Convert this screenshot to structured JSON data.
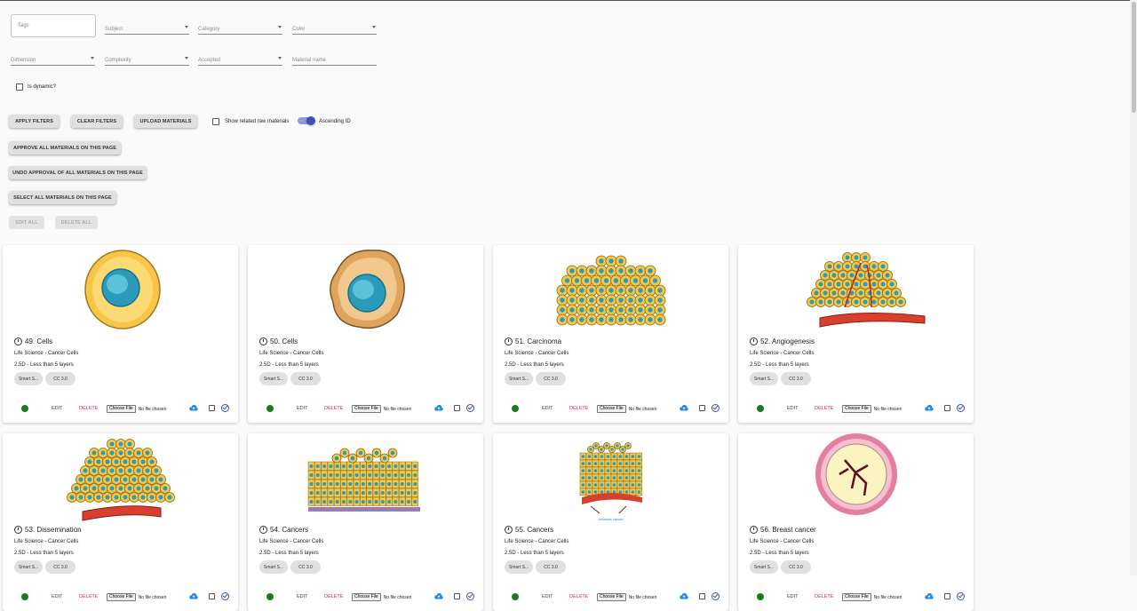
{
  "filters": {
    "tags_placeholder": "Tags",
    "subject": "Subject",
    "category": "Category",
    "color": "Color",
    "dimension": "Dimension",
    "complexity": "Complexity",
    "accepted": "Accepted",
    "material_name": "Material name",
    "is_dynamic": "Is dynamic?"
  },
  "actions": {
    "apply": "APPLY FILTERS",
    "clear": "CLEAR FILTERS",
    "upload": "UPLOAD MATERIALS",
    "show_related": "Show related raw materials",
    "ascending": "Ascending ID",
    "approve_all": "APPROVE ALL MATERIALS ON THIS PAGE",
    "undo_approval": "UNDO APPROVAL OF ALL MATERIALS ON THIS PAGE",
    "select_all": "SELECT ALL MATERIALS ON THIS PAGE",
    "edit_all": "EDIT ALL",
    "delete_all": "DELETE ALL"
  },
  "card_common": {
    "edit": "EDIT",
    "delete": "DELETE",
    "choose_file": "Choose File",
    "no_file": "No file chosen",
    "chip1": "Smart S...",
    "chip2": "CC 3.0",
    "status_color": "#1b7a1b"
  },
  "cards": [
    {
      "title": "49. Cells",
      "subtitle": "Life Science - Cancer Cells",
      "detail": "2.5D - Less than 5 layers"
    },
    {
      "title": "50. Cells",
      "subtitle": "Life Science - Cancer Cells",
      "detail": "2.5D - Less than 5 layers"
    },
    {
      "title": "51. Carcinoma",
      "subtitle": "Life Science - Cancer Cells",
      "detail": "2.5D - Less than 5 layers"
    },
    {
      "title": "52. Angiogenesis",
      "subtitle": "Life Science - Cancer Cells",
      "detail": "2.5D - Less than 5 layers"
    },
    {
      "title": "53. Dissemination",
      "subtitle": "Life Science - Cancer Cells",
      "detail": "2.5D - Less than 5 layers"
    },
    {
      "title": "54. Cancers",
      "subtitle": "Life Science - Cancer Cells",
      "detail": "2.5D - Less than 5 layers"
    },
    {
      "title": "55. Cancers",
      "subtitle": "Life Science - Cancer Cells",
      "detail": "2.5D - Less than 5 layers",
      "image_caption": "Invasive cancer"
    },
    {
      "title": "56. Breast cancer",
      "subtitle": "Life Science - Cancer Cells",
      "detail": "2.5D - Less than 5 layers"
    }
  ]
}
